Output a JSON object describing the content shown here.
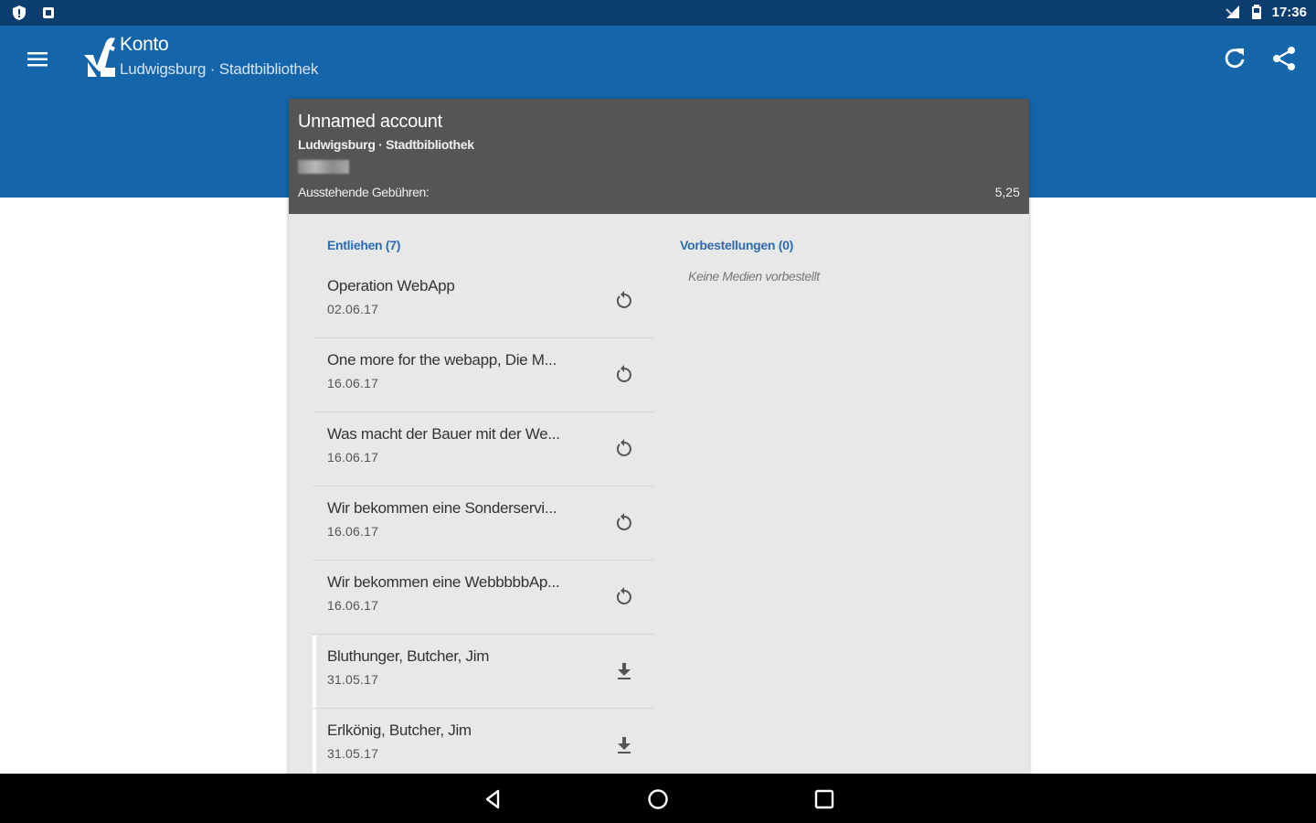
{
  "status_bar": {
    "time": "17:36",
    "left_icons": [
      "shield-alert-icon",
      "square-notification-icon"
    ],
    "right_icons": [
      "signal-no-data-icon",
      "battery-icon"
    ]
  },
  "app_bar": {
    "title": "Konto",
    "subtitle": "Ludwigsburg · Stadtbibliothek",
    "icons": [
      "menu-icon",
      "app-logo-icon",
      "refresh-icon",
      "share-icon"
    ],
    "color": "#1565ab"
  },
  "account": {
    "name": "Unnamed account",
    "library": "Ludwigsburg · Stadtbibliothek",
    "fees_label": "Ausstehende Gebühren:",
    "fees_value": "5,25"
  },
  "lent": {
    "title": "Entliehen (7)",
    "items": [
      {
        "title": "Operation WebApp",
        "date": "02.06.17",
        "action": "renew-icon"
      },
      {
        "title": "One more for the webapp, Die M...",
        "date": "16.06.17",
        "action": "renew-icon"
      },
      {
        "title": "Was macht der Bauer mit der We...",
        "date": "16.06.17",
        "action": "renew-icon"
      },
      {
        "title": "Wir bekommen eine Sonderservi...",
        "date": "16.06.17",
        "action": "renew-icon"
      },
      {
        "title": "Wir bekommen eine WebbbbbAp...",
        "date": "16.06.17",
        "action": "renew-icon"
      },
      {
        "title": "Bluthunger, Butcher, Jim",
        "date": "31.05.17",
        "action": "download-icon"
      },
      {
        "title": "Erlkönig, Butcher, Jim",
        "date": "31.05.17",
        "action": "download-icon"
      }
    ]
  },
  "reservations": {
    "title": "Vorbestellungen (0)",
    "empty_text": "Keine Medien vorbestellt"
  },
  "nav_bar": {
    "icons": [
      "back-icon",
      "home-icon",
      "recents-icon"
    ]
  }
}
